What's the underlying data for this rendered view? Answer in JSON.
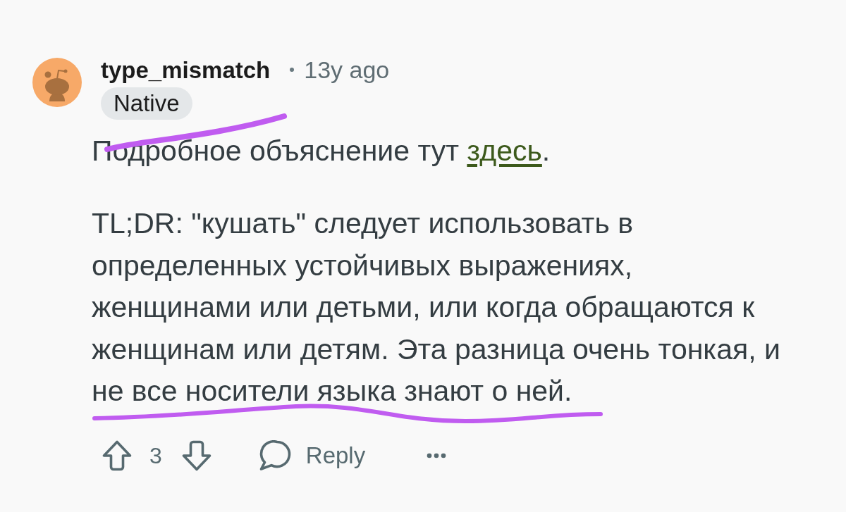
{
  "comment": {
    "author": "type_mismatch",
    "time": "13y ago",
    "flair": "Native",
    "paragraphs": [
      {
        "lines": [
          [
            {
              "kind": "text",
              "text": "Подробное объяснение тут "
            },
            {
              "kind": "link",
              "text": "здесь"
            },
            {
              "kind": "text",
              "text": "."
            }
          ]
        ]
      },
      {
        "lines": [
          [
            {
              "kind": "text",
              "text": "TL;DR: \"кушать\" следует использовать в"
            }
          ],
          [
            {
              "kind": "text",
              "text": "определенных устойчивых выражениях,"
            }
          ],
          [
            {
              "kind": "text",
              "text": "женщинами или детьми, или когда обращаются к"
            }
          ],
          [
            {
              "kind": "text",
              "text": "женщинам или детям. Эта разница очень тонкая, и"
            }
          ],
          [
            {
              "kind": "text",
              "text": "не все носители языка знают о ней."
            }
          ]
        ]
      }
    ]
  },
  "actions": {
    "vote_count": "3",
    "reply_label": "Reply"
  },
  "marker_strokes": {
    "under_flair": true,
    "under_last_line": true
  }
}
